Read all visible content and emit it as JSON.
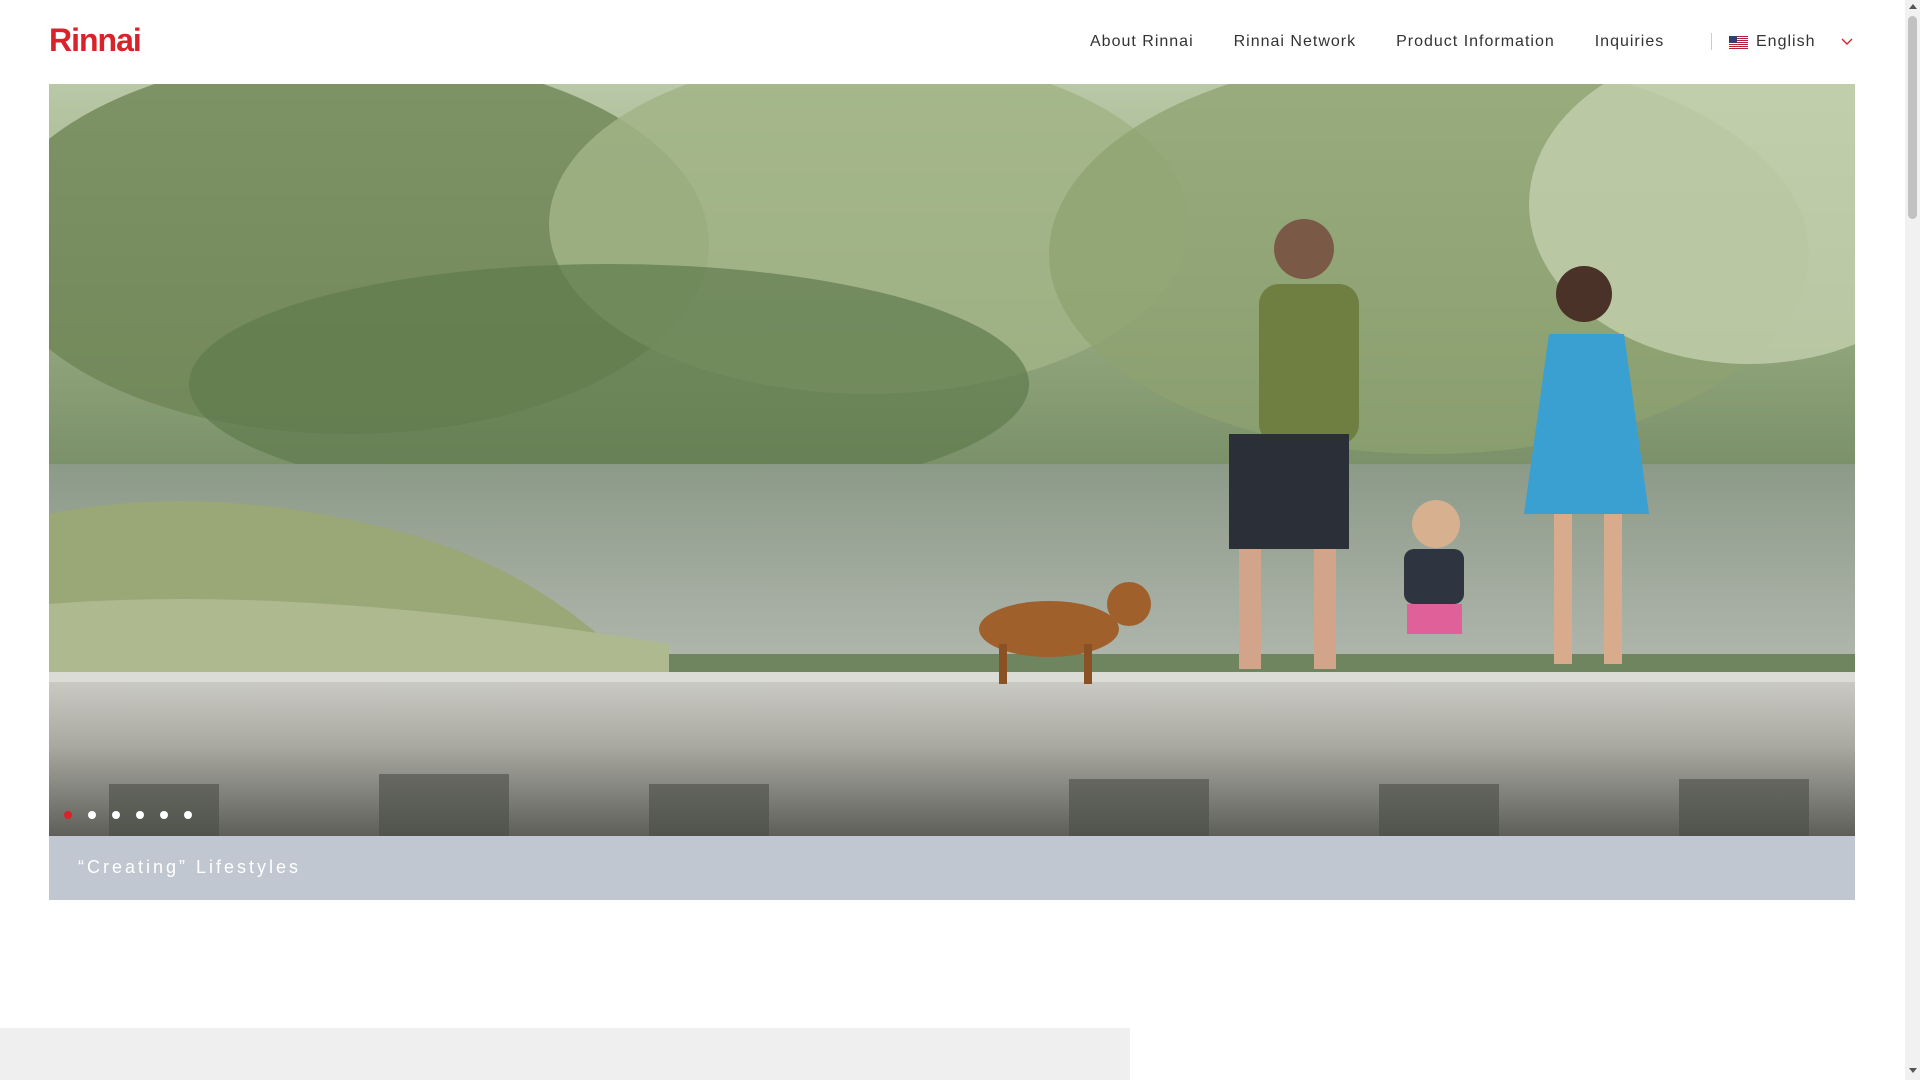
{
  "header": {
    "logo_text": "Rinnai",
    "nav": [
      {
        "label": "About Rinnai"
      },
      {
        "label": "Rinnai Network"
      },
      {
        "label": "Product Information"
      },
      {
        "label": "Inquiries"
      }
    ],
    "language": {
      "label": "English",
      "flag_icon": "us-flag-icon",
      "chevron_icon": "chevron-down-icon"
    }
  },
  "hero": {
    "caption": "“Creating” Lifestyles",
    "slides_total": 6,
    "active_slide": 1
  },
  "colors": {
    "brand_red": "#d8232a",
    "caption_bar": "#c1c7d0",
    "lower_panel": "#efefef"
  }
}
